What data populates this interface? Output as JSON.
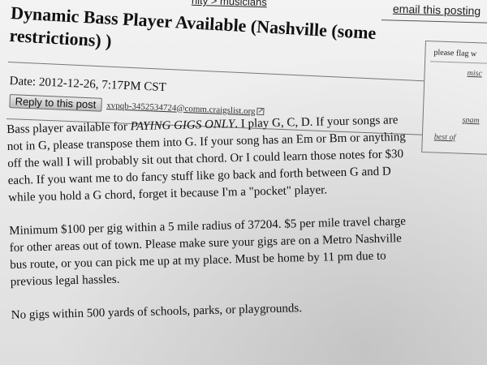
{
  "breadcrumb": {
    "partial_text": "nity > musicians"
  },
  "header": {
    "email_link": "email this posting"
  },
  "post": {
    "title": "Dynamic Bass Player Available (Nashville (some restrictions) )",
    "date": "Date: 2012-12-26, 7:17PM CST",
    "reply_button": "Reply to this post",
    "reply_email": "xvpqb-3452534724@comm.craigslist.org",
    "paragraphs": {
      "p1_a": "Bass player available for ",
      "p1_caps": "PAYING GIGS ONLY",
      "p1_b": ". I play G, C, D. If your songs are not in G, please transpose them into G. If your song has an Em or Bm or anything off the wall I will probably sit out that chord. Or I could learn those notes for $30 each. If you want me to do fancy stuff like go back and forth between G and D while you hold a G chord, forget it because I'm a \"pocket\" player.",
      "p2": "Minimum $100 per gig within a 5 mile radius of 37204. $5 per mile travel charge for other areas out of town. Please make sure your gigs are on a Metro Nashville bus route, or you can pick me up at my place. Must be home by 11 pm due to previous legal hassles.",
      "p3": "No gigs within 500 yards of schools, parks, or playgrounds."
    }
  },
  "flag_box": {
    "title": "please flag w",
    "misc": "misc",
    "spam": "spam",
    "best_of": "best of"
  },
  "icons": {
    "external_link": "external-link-icon"
  }
}
